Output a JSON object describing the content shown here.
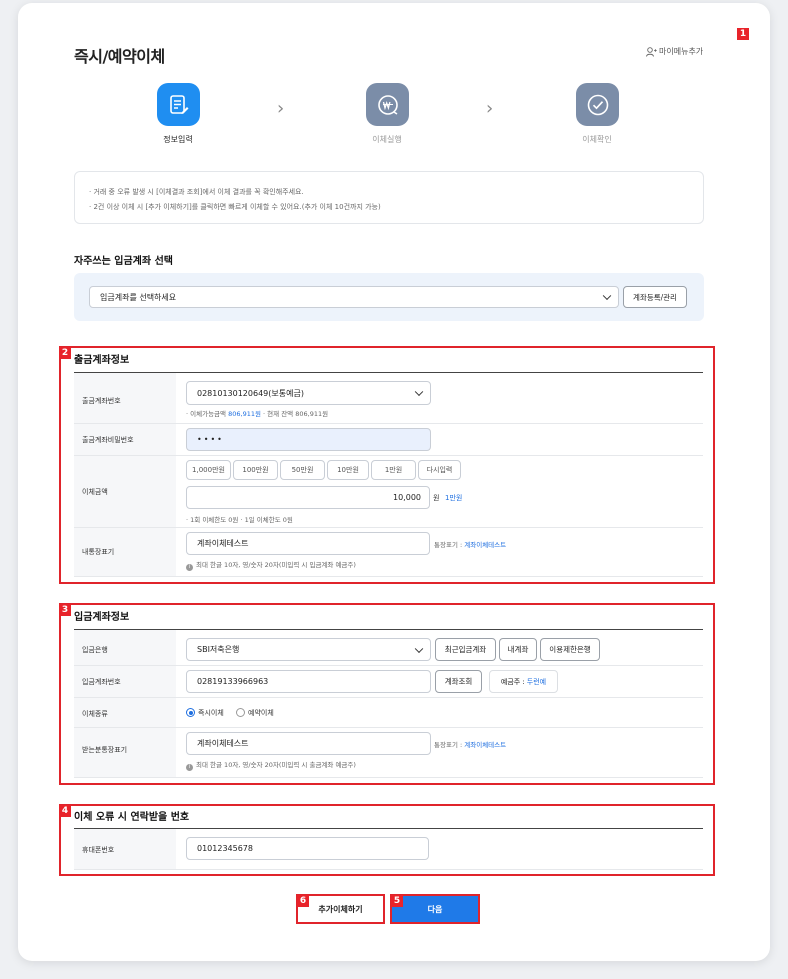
{
  "page": {
    "title": "즉시/예약이체",
    "my_menu_label": "마이메뉴추가"
  },
  "badges": [
    "1",
    "2",
    "3",
    "4",
    "5",
    "6"
  ],
  "steps": [
    {
      "label": "정보입력",
      "icon": "document-edit-icon",
      "color": "#1f8ef1"
    },
    {
      "label": "이체실행",
      "icon": "won-transfer-icon",
      "color": "#7b8da8"
    },
    {
      "label": "이체확인",
      "icon": "check-circle-icon",
      "color": "#7b8da8"
    }
  ],
  "notice": [
    "· 거래 중 오류 발생 시 [이체결과 조회]에서 이체 결과를 꼭 확인해주세요.",
    "· 2건 이상 이체 시 [추가 이체하기]를 클릭하면 빠르게 이체할 수 있어요.(추가 이체 10건까지 가능)"
  ],
  "favorite": {
    "heading": "자주쓰는 입금계좌 선택",
    "select_value": "입금계좌를 선택하세요",
    "manage_button": "계좌등록/관리"
  },
  "withdraw": {
    "title": "출금계좌정보",
    "account_label": "출금계좌번호",
    "account_value": "02810130120649(보통예금)",
    "balance_prefix": "· 이체가능금액",
    "balance_value": "806,911원",
    "balance_suffix": "· 현재 잔액 806,911원",
    "password_label": "출금계좌비밀번호",
    "password_value": "••••",
    "amount_label": "이체금액",
    "amount_buttons": [
      "1,000만원",
      "100만원",
      "50만원",
      "10만원",
      "1만원",
      "다시입력"
    ],
    "amount_value": "10,000",
    "amount_unit": "원",
    "amount_korean": "1만원",
    "limit_text": "· 1회 이체한도 0원 · 1일 이체한도 0원",
    "memo_label": "내통장표기",
    "memo_value": "계좌이체테스트",
    "memo_preview_prefix": "통장표기 :",
    "memo_preview_value": "계좌이체테스트",
    "memo_hint": "최대 한글 10자, 영/숫자 20자(미입력 시 입금계좌 예금주)"
  },
  "deposit": {
    "title": "입금계좌정보",
    "bank_label": "입금은행",
    "bank_value": "SBI저축은행",
    "recent_button": "최근입금계좌",
    "my_button": "내계좌",
    "restricted_button": "이용제한은행",
    "account_label": "입금계좌번호",
    "account_value": "02819133966963",
    "lookup_button": "계좌조회",
    "holder_prefix": "예금주 :",
    "holder_value": "두런예",
    "type_label": "이체종류",
    "type_options": [
      "즉시이체",
      "예약이체"
    ],
    "memo_label": "받는분통장표기",
    "memo_value": "계좌이체테스트",
    "memo_preview_prefix": "통장표기 :",
    "memo_preview_value": "계좌이체테스트",
    "memo_hint": "최대 한글 10자, 영/숫자 20자(미입력 시 출금계좌 예금주)"
  },
  "contact": {
    "title": "이체 오류 시 연락받을 번호",
    "phone_label": "휴대폰번호",
    "phone_value": "01012345678"
  },
  "actions": {
    "add_transfer": "추가이체하기",
    "next": "다음"
  },
  "colors": {
    "primary": "#1f6fe0",
    "next_button": "#1f7ae8",
    "highlight_red": "#e0242b"
  }
}
